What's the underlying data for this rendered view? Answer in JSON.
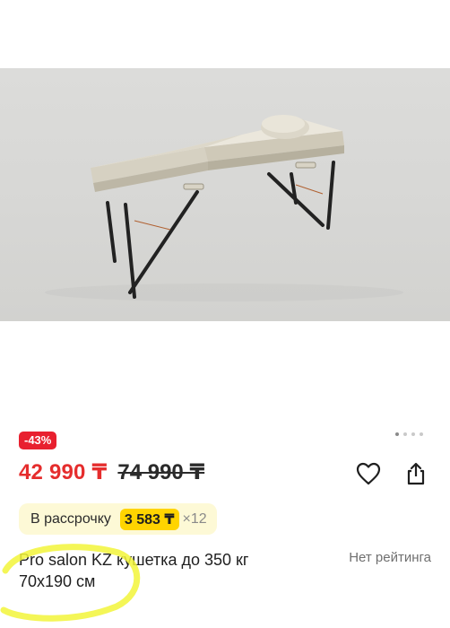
{
  "product": {
    "image_alt": "massage table photo",
    "discount_badge": "-43%",
    "price_current": "42 990 ₸",
    "price_old": "74 990 ₸",
    "installment": {
      "label": "В рассрочку",
      "amount": "3 583 ₸",
      "multiplier": "×12"
    },
    "title": "Pro salon KZ кушетка до 350 кг 70x190 см",
    "rating_text": "Нет рейтинга"
  },
  "carousel": {
    "total_dots": 4,
    "active_index": 0
  },
  "icons": {
    "favorite": "heart-icon",
    "share": "share-icon"
  },
  "colors": {
    "price_accent": "#e52d2d",
    "badge_bg": "#e8202f",
    "installment_bg": "#fdf9d6",
    "installment_amount_bg": "#ffd400",
    "highlighter": "#f2f53a"
  }
}
